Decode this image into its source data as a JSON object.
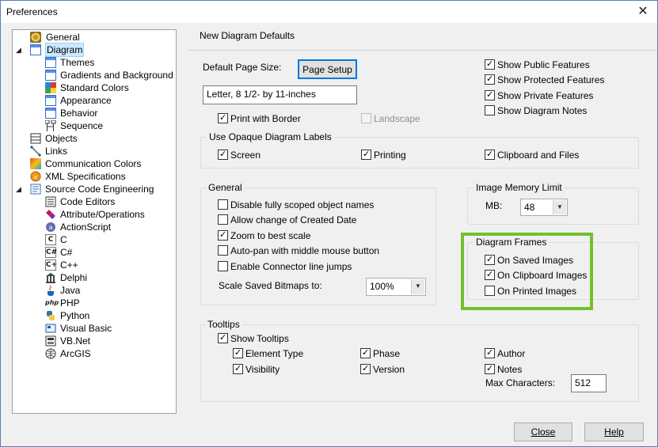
{
  "window": {
    "title": "Preferences",
    "close_glyph": "✕"
  },
  "tree": {
    "items": [
      {
        "label": "General",
        "icon": "general-gear-icon"
      },
      {
        "label": "Diagram",
        "icon": "diagram-page-icon"
      },
      {
        "label": "Themes",
        "icon": "themes-page-icon"
      },
      {
        "label": "Gradients and Background",
        "icon": "gradients-page-icon"
      },
      {
        "label": "Standard Colors",
        "icon": "standard-colors-icon"
      },
      {
        "label": "Appearance",
        "icon": "appearance-page-icon"
      },
      {
        "label": "Behavior",
        "icon": "behavior-page-icon"
      },
      {
        "label": "Sequence",
        "icon": "sequence-icon"
      },
      {
        "label": "Objects",
        "icon": "objects-icon"
      },
      {
        "label": "Links",
        "icon": "links-icon"
      },
      {
        "label": "Communication Colors",
        "icon": "communication-colors-icon"
      },
      {
        "label": "XML Specifications",
        "icon": "xml-icon"
      },
      {
        "label": "Source Code Engineering",
        "icon": "source-code-icon"
      },
      {
        "label": "Code Editors",
        "icon": "code-editors-icon"
      },
      {
        "label": "Attribute/Operations",
        "icon": "attribute-operations-icon"
      },
      {
        "label": "ActionScript",
        "icon": "actionscript-icon"
      },
      {
        "label": "C",
        "icon": "c-language-icon"
      },
      {
        "label": "C#",
        "icon": "csharp-language-icon"
      },
      {
        "label": "C++",
        "icon": "cpp-language-icon"
      },
      {
        "label": "Delphi",
        "icon": "delphi-icon"
      },
      {
        "label": "Java",
        "icon": "java-icon"
      },
      {
        "label": "PHP",
        "icon": "php-icon"
      },
      {
        "label": "Python",
        "icon": "python-icon"
      },
      {
        "label": "Visual Basic",
        "icon": "visual-basic-icon"
      },
      {
        "label": "VB.Net",
        "icon": "vbnet-icon"
      },
      {
        "label": "ArcGIS",
        "icon": "arcgis-icon"
      }
    ],
    "lang_glyphs": {
      "c": "C",
      "csharp": "C#",
      "cpp": "C+",
      "php": "php"
    }
  },
  "panel": {
    "heading": "New Diagram Defaults",
    "page_size": {
      "label": "Default Page Size:",
      "button": "Page Setup",
      "value": "Letter, 8 1/2- by 11-inches"
    },
    "print_with_border": "Print with Border",
    "landscape": "Landscape",
    "show_features": [
      {
        "label": "Show Public Features",
        "checked": true
      },
      {
        "label": "Show Protected Features",
        "checked": true
      },
      {
        "label": "Show Private Features",
        "checked": true
      },
      {
        "label": "Show Diagram Notes",
        "checked": false
      }
    ],
    "opaque_labels": {
      "title": "Use Opaque Diagram Labels",
      "screen": "Screen",
      "printing": "Printing",
      "clipboard": "Clipboard and Files"
    },
    "general": {
      "title": "General",
      "options": [
        {
          "label": "Disable fully scoped object names",
          "checked": false
        },
        {
          "label": "Allow change of Created Date",
          "checked": false
        },
        {
          "label": "Zoom to best scale",
          "checked": true
        },
        {
          "label": "Auto-pan with middle mouse button",
          "checked": false
        },
        {
          "label": "Enable Connector line jumps",
          "checked": false
        }
      ],
      "scale_label": "Scale Saved Bitmaps to:",
      "scale_value": "100%"
    },
    "image_memory": {
      "title": "Image Memory Limit",
      "mb_label": "MB:",
      "mb_value": "48"
    },
    "diagram_frames": {
      "title": "Diagram Frames",
      "options": [
        {
          "label": "On Saved Images",
          "checked": true
        },
        {
          "label": "On Clipboard Images",
          "checked": true
        },
        {
          "label": "On Printed Images",
          "checked": false
        }
      ]
    },
    "tooltips": {
      "title": "Tooltips",
      "show_tooltips": "Show Tooltips",
      "element_type": "Element Type",
      "visibility": "Visibility",
      "phase": "Phase",
      "version": "Version",
      "author": "Author",
      "notes": "Notes",
      "max_chars_label": "Max Characters:",
      "max_chars_value": "512"
    }
  },
  "footer": {
    "close": "Close",
    "help": "Help"
  },
  "colors": {
    "highlight": "#72c02c",
    "selection": "#cce8ff",
    "accent": "#0078d7"
  }
}
